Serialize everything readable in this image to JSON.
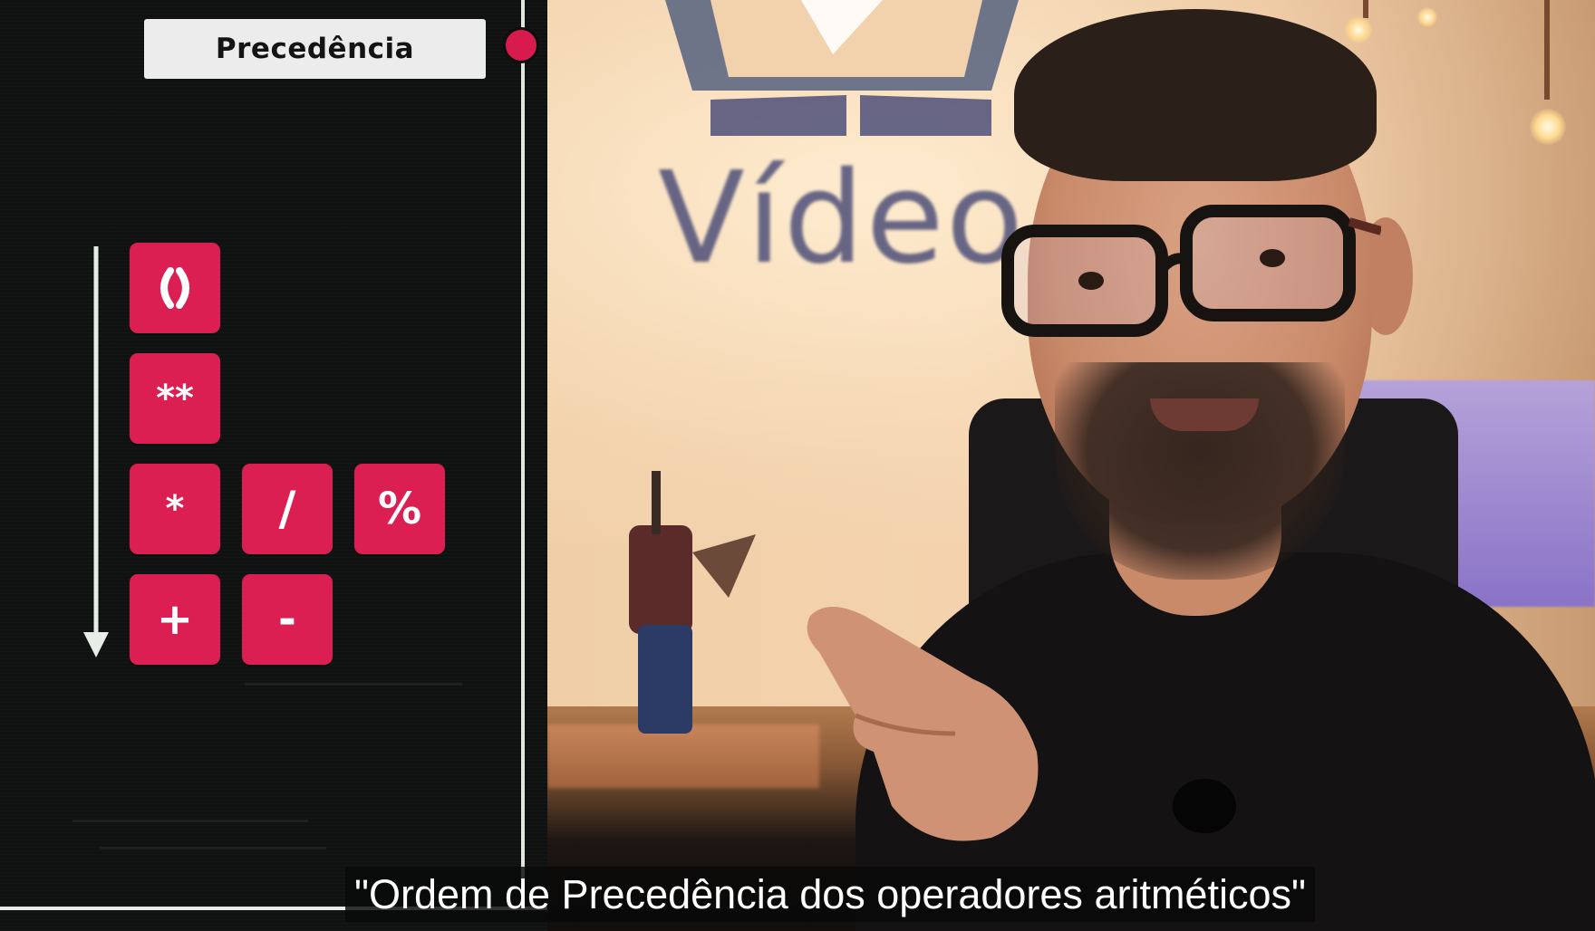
{
  "slide": {
    "title": "Precedência",
    "accent_color": "#dc1f53",
    "direction_indicator": "down-arrow-icon",
    "rows": [
      [
        "()"
      ],
      [
        "**"
      ],
      [
        "*",
        "/",
        "%"
      ],
      [
        "+",
        "-"
      ]
    ]
  },
  "video": {
    "wall_logo_text": "Vídeo",
    "logo_icon": "play-icon"
  },
  "subtitle": {
    "text": "\"Ordem de Precedência dos operadores aritméticos\""
  }
}
